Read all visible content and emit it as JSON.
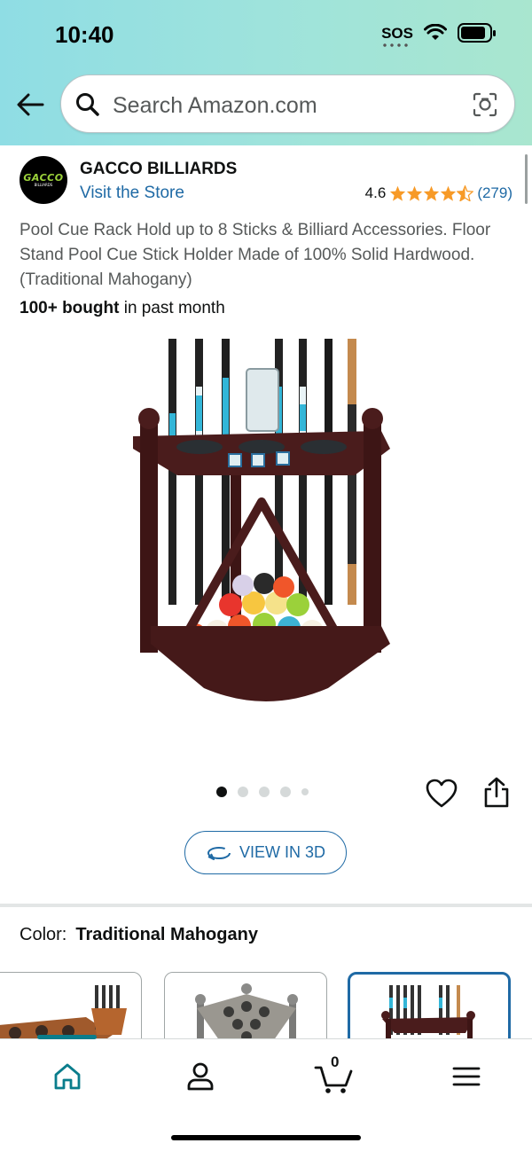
{
  "status_bar": {
    "time": "10:40",
    "sos": "SOS"
  },
  "search": {
    "placeholder": "Search Amazon.com"
  },
  "brand": {
    "logo_text": "GACCO",
    "logo_subtext": "BILLIARDS",
    "name": "GACCO BILLIARDS",
    "store_link": "Visit the Store",
    "rating": "4.6",
    "rating_stars": 4.6,
    "review_count": "(279)"
  },
  "product": {
    "title": "Pool Cue Rack Hold up to 8 Sticks & Billiard Accessories. Floor Stand Pool Cue Stick Holder Made of 100% Solid Hardwood.(Traditional Mahogany)",
    "bought_bold": "100+ bought",
    "bought_rest": " in past month",
    "image_count": 5,
    "active_image": 1
  },
  "view_3d": {
    "label": "VIEW IN 3D"
  },
  "color": {
    "label": "Color:",
    "value": "Traditional Mahogany",
    "options": [
      "natural",
      "grey",
      "mahogany"
    ],
    "selected": 2
  },
  "nav": {
    "items": [
      "home-icon",
      "account-icon",
      "cart-icon",
      "menu-icon"
    ],
    "active": 0,
    "cart_count": "0"
  },
  "colors": {
    "accent": "#1f6aa5",
    "teal": "#0a7d8c",
    "star": "#f79a27",
    "mahogany": "#4a1c1c"
  }
}
